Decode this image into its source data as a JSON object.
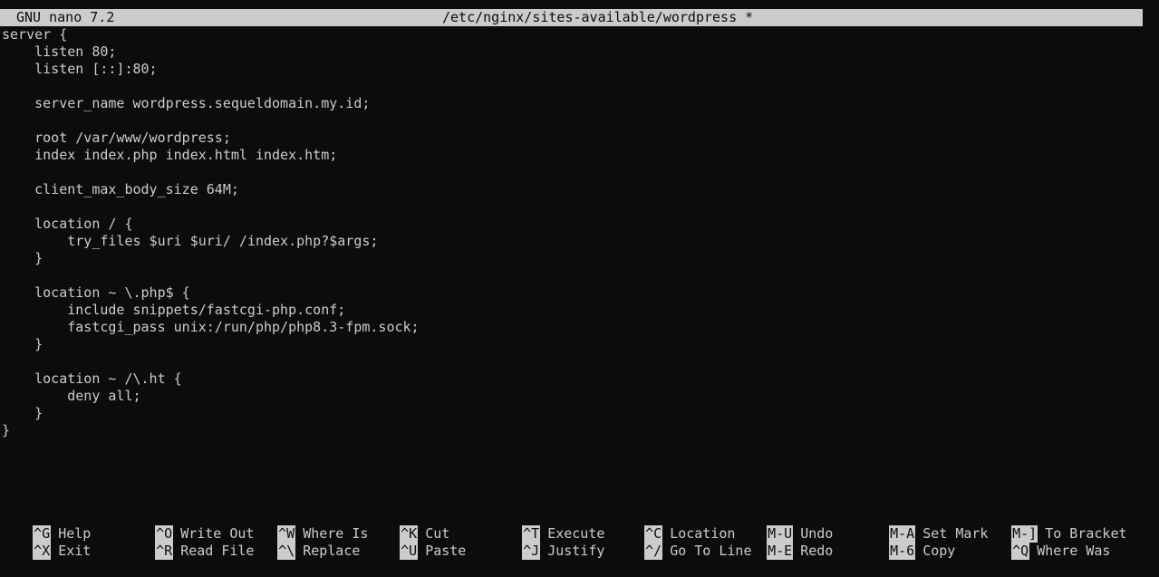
{
  "titlebar": {
    "app": "GNU nano 7.2",
    "file": "/etc/nginx/sites-available/wordpress *"
  },
  "editor": {
    "lines": [
      "server {",
      "    listen 80;",
      "    listen [::]:80;",
      "",
      "    server_name wordpress.sequeldomain.my.id;",
      "",
      "    root /var/www/wordpress;",
      "    index index.php index.html index.htm;",
      "",
      "    client_max_body_size 64M;",
      "",
      "    location / {",
      "        try_files $uri $uri/ /index.php?$args;",
      "    }",
      "",
      "    location ~ \\.php$ {",
      "        include snippets/fastcgi-php.conf;",
      "        fastcgi_pass unix:/run/php/php8.3-fpm.sock;",
      "    }",
      "",
      "    location ~ /\\.ht {",
      "        deny all;",
      "    }",
      "}"
    ]
  },
  "shortcuts": {
    "row1": [
      {
        "key": "^G",
        "label": "Help"
      },
      {
        "key": "^O",
        "label": "Write Out"
      },
      {
        "key": "^W",
        "label": "Where Is"
      },
      {
        "key": "^K",
        "label": "Cut"
      },
      {
        "key": "^T",
        "label": "Execute"
      },
      {
        "key": "^C",
        "label": "Location"
      },
      {
        "key": "M-U",
        "label": "Undo"
      },
      {
        "key": "M-A",
        "label": "Set Mark"
      },
      {
        "key": "M-]",
        "label": "To Bracket"
      }
    ],
    "row2": [
      {
        "key": "^X",
        "label": "Exit"
      },
      {
        "key": "^R",
        "label": "Read File"
      },
      {
        "key": "^\\",
        "label": "Replace"
      },
      {
        "key": "^U",
        "label": "Paste"
      },
      {
        "key": "^J",
        "label": "Justify"
      },
      {
        "key": "^/",
        "label": "Go To Line"
      },
      {
        "key": "M-E",
        "label": "Redo"
      },
      {
        "key": "M-6",
        "label": "Copy"
      },
      {
        "key": "^Q",
        "label": "Where Was"
      }
    ]
  }
}
